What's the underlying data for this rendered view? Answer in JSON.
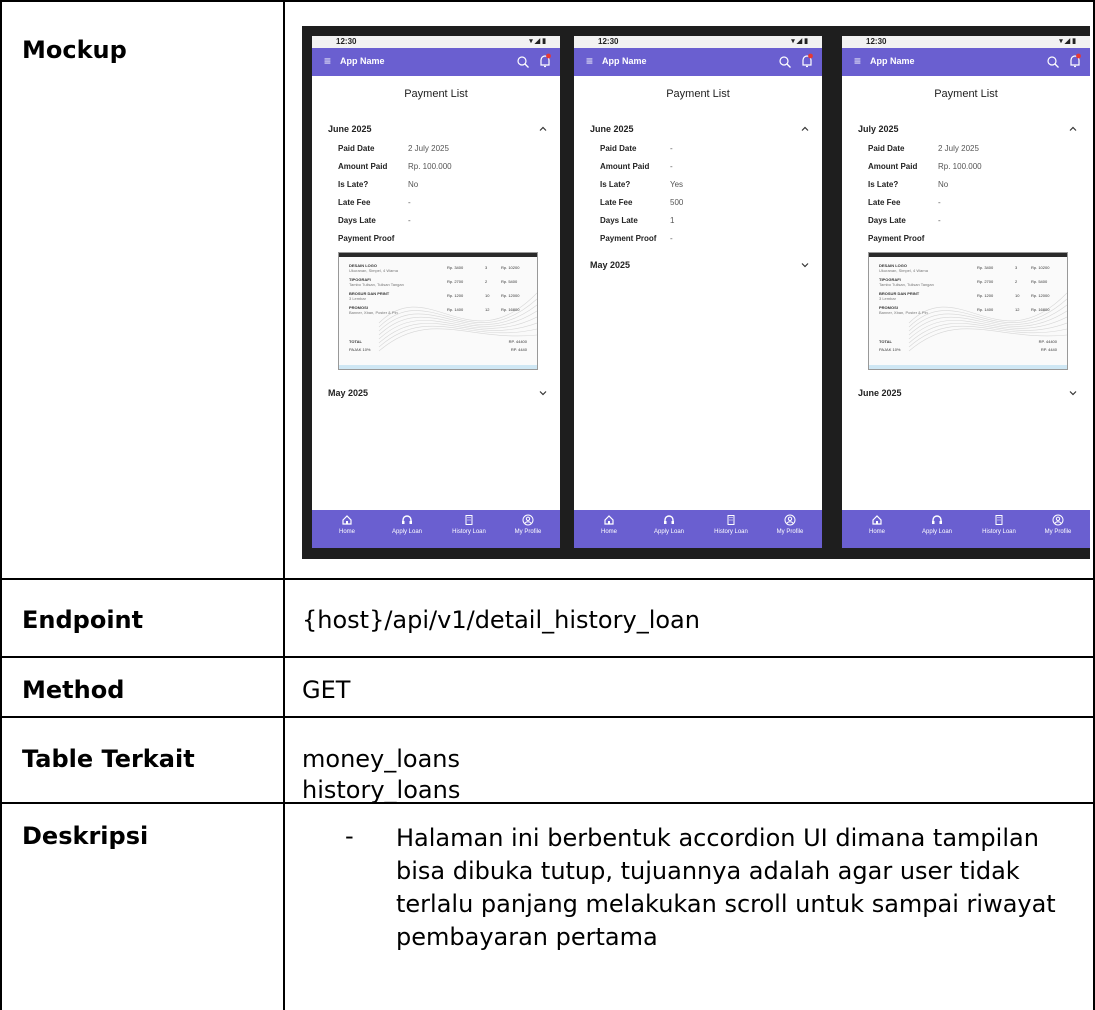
{
  "table": {
    "rows": [
      {
        "label": "Mockup"
      },
      {
        "label": "Endpoint",
        "value": "{host}/api/v1/detail_history_loan"
      },
      {
        "label": "Method",
        "value": "GET"
      },
      {
        "label": "Table Terkait",
        "values": [
          "money_loans",
          "history_loans"
        ]
      },
      {
        "label": "Deskripsi",
        "bullet": "-",
        "text": "Halaman ini berbentuk accordion UI dimana tampilan bisa dibuka tutup, tujuannya adalah agar user tidak terlalu panjang melakukan scroll untuk sampai riwayat pembayaran pertama"
      }
    ]
  },
  "mockup": {
    "colors": {
      "primary": "#6a5fd0",
      "frame": "#1e1e1e",
      "notification_dot": "#e53935"
    },
    "status_time": "12:30",
    "app_name": "App Name",
    "page_title": "Payment List",
    "field_labels": {
      "paid_date": "Paid Date",
      "amount_paid": "Amount Paid",
      "is_late": "Is Late?",
      "late_fee": "Late Fee",
      "days_late": "Days Late",
      "payment_proof": "Payment Proof"
    },
    "nav": [
      "Home",
      "Apply Loan",
      "History Loan",
      "My Profile"
    ],
    "nav_icons": [
      "home-icon",
      "headset-icon",
      "building-icon",
      "profile-icon"
    ],
    "screens": [
      {
        "open_section": "June 2025",
        "fields": {
          "paid_date": "2 July 2025",
          "amount_paid": "Rp. 100.000",
          "is_late": "No",
          "late_fee": "-",
          "days_late": "-"
        },
        "collapsed_section": "May 2025"
      },
      {
        "open_section": "June 2025",
        "fields": {
          "paid_date": "-",
          "amount_paid": "-",
          "is_late": "Yes",
          "late_fee": "500",
          "days_late": "1",
          "payment_proof": "-"
        },
        "collapsed_section": "May 2025"
      },
      {
        "open_section": "July 2025",
        "fields": {
          "paid_date": "2 July 2025",
          "amount_paid": "Rp. 100.000",
          "is_late": "No",
          "late_fee": "-",
          "days_late": "-"
        },
        "collapsed_section": "June 2025"
      }
    ],
    "invoice": {
      "items": [
        {
          "name": "DESAIN LOGO",
          "sub": "Ukuranan, Simpel, 4 Warna",
          "price": "Rp. 3400",
          "qty": "3",
          "total": "Rp. 10200"
        },
        {
          "name": "TIPOGRAFI",
          "sub": "Tambo Tulisan, Tulisan Tangan",
          "price": "Rp. 2700",
          "qty": "2",
          "total": "Rp. 5400"
        },
        {
          "name": "BROSUR DAN PRINT",
          "sub": "3 Lembar",
          "price": "Rp. 1200",
          "qty": "10",
          "total": "Rp. 12000"
        },
        {
          "name": "PROMOSI",
          "sub": "Banner, Xban, Poster & Pin",
          "price": "Rp. 1400",
          "qty": "12",
          "total": "Rp. 16800"
        }
      ],
      "total_label": "TOTAL",
      "total_value": "RP. 44400",
      "tax_label": "PAJAK 10%",
      "tax_value": "RP. 4440"
    }
  }
}
